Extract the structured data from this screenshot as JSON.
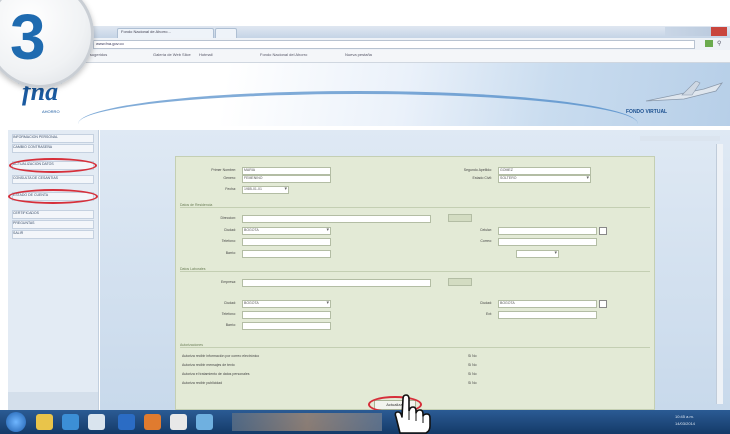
{
  "step": {
    "number": "3"
  },
  "browser": {
    "tabs": [
      {
        "label": "Fondo Nacional de Ahorro..."
      },
      {
        "label": ""
      }
    ],
    "url": "www.fna.gov.co",
    "bookmarks": [
      "Sitios sugeridos",
      "Galería de Web Slice",
      "Hotmail",
      "Fondo Nacional del Ahorro",
      "Nueva pestaña"
    ]
  },
  "banner": {
    "logo_text": "fna",
    "logo_sub": "AHORRO",
    "title": "FONDO VIRTUAL"
  },
  "sidebar": {
    "items": [
      {
        "label": "INFORMACION PERSONAL"
      },
      {
        "label": "CAMBIO CONTRASEÑA"
      },
      {
        "label": "ACTUALIZACION DATOS"
      },
      {
        "label": "CONSULTA DE CESANTIAS"
      },
      {
        "label": "ESTADO DE CUENTA"
      },
      {
        "label": "CERTIFICADOS"
      },
      {
        "label": "PREGUNTAS"
      },
      {
        "label": "SALIR"
      }
    ]
  },
  "form": {
    "fields_top": [
      {
        "label": "Primer Nombre:",
        "value": "MARIA"
      },
      {
        "label": "Segundo Apellido:",
        "value": "GOMEZ"
      },
      {
        "label": "Genero:",
        "value": "FEMENINO"
      },
      {
        "label": "Estado Civil:",
        "value": "SOLTERO"
      },
      {
        "label": "Fecha:",
        "value": "1985-01-01"
      }
    ],
    "section1": "Datos de Residencia",
    "fields_residence": [
      {
        "label": "Direccion:",
        "value": ""
      },
      {
        "label": "Ciudad:",
        "value": "BOGOTA"
      },
      {
        "label": "Telefono:",
        "value": ""
      },
      {
        "label": "Barrio:",
        "value": ""
      },
      {
        "label": "Celular:",
        "value": ""
      },
      {
        "label": "Correo:",
        "value": ""
      }
    ],
    "section2": "Datos Laborales",
    "fields_work": [
      {
        "label": "Empresa:",
        "value": ""
      },
      {
        "label": "Ciudad:",
        "value": "BOGOTA"
      },
      {
        "label": "Telefono:",
        "value": ""
      },
      {
        "label": "Barrio:",
        "value": ""
      },
      {
        "label": "Ext:",
        "value": ""
      }
    ],
    "section3": "Autorizaciones",
    "questions": [
      {
        "label": "Autoriza recibir información por correo electrónico",
        "options": "Si  No"
      },
      {
        "label": "Autoriza recibir mensajes de texto",
        "options": "Si  No"
      },
      {
        "label": "Autoriza el tratamiento de datos personales",
        "options": "Si  No"
      },
      {
        "label": "Autoriza recibir publicidad",
        "options": "Si  No"
      }
    ],
    "submit": {
      "label": "Actualizar"
    }
  },
  "taskbar": {
    "clock": "10:45 a.m.",
    "date": "14/03/2014"
  },
  "colors": {
    "accent": "#1f6bb0",
    "highlight": "#d62f3a",
    "form_bg": "#e3ead6"
  }
}
